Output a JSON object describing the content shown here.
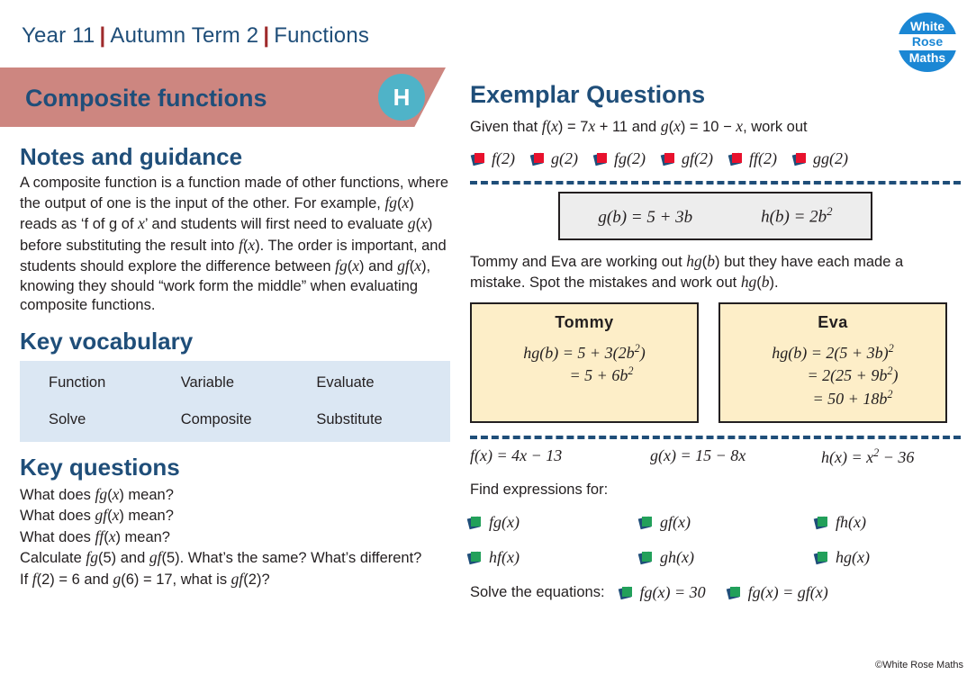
{
  "header": {
    "year": "Year 11",
    "term": "Autumn Term 2",
    "topic": "Functions",
    "separator": "|"
  },
  "logo": {
    "line1": "White",
    "line2": "Rose",
    "line3": "Maths",
    "brand_color": "#1b87d4"
  },
  "banner": {
    "title": "Composite functions",
    "tier_badge": "H",
    "banner_color": "#cd8680",
    "badge_color": "#4fb3c8",
    "title_color": "#1f4e79"
  },
  "left": {
    "notes_heading": "Notes and guidance",
    "notes_body": "A composite function is a function made of other functions, where the output of one is the input of the other. For example, fg(x) reads as ‘f of g of x’ and students will first need to evaluate g(x) before substituting the result into f(x). The order is important, and students should explore the difference between fg(x) and gf(x), knowing they should “work form the middle” when evaluating composite functions.",
    "vocab_heading": "Key vocabulary",
    "vocab_rows": [
      [
        "Function",
        "Variable",
        "Evaluate"
      ],
      [
        "Solve",
        "Composite",
        "Substitute"
      ]
    ],
    "vocab_bg": "#dbe7f3",
    "questions_heading": "Key questions",
    "questions": [
      "What does fg(x) mean?",
      "What does gf(x) mean?",
      "What does ff(x) mean?",
      "Calculate fg(5) and gf(5). What’s the same? What’s different?",
      "If f(2) = 6 and g(6) = 17, what is gf(2)?"
    ]
  },
  "right": {
    "title": "Exemplar Questions",
    "given_text": "Given that f(x) = 7x + 11 and g(x) = 10 − x, work out",
    "q1_bullets": [
      "f(2)",
      "g(2)",
      "fg(2)",
      "gf(2)",
      "ff(2)",
      "gg(2)"
    ],
    "q1_bullet_color": "#e8112d",
    "definition_box": {
      "left": "g(b) = 5 + 3b",
      "right": "h(b) = 2b²"
    },
    "tommy_eva_prompt": "Tommy and Eva are working out hg(b) but they have each made a mistake. Spot the mistakes and work out hg(b).",
    "tommy": {
      "name": "Tommy",
      "lines": [
        "hg(b) = 5 + 3(2b²)",
        "= 5 + 6b²"
      ]
    },
    "eva": {
      "name": "Eva",
      "lines": [
        "hg(b) = 2(5 + 3b)²",
        "= 2(25 + 9b²)",
        "= 50 + 18b²"
      ]
    },
    "card_bg": "#fdeec8",
    "functions": [
      "f(x) = 4x − 13",
      "g(x) = 15 − 8x",
      "h(x) = x² − 36"
    ],
    "find_label": "Find expressions for:",
    "expressions": [
      "fg(x)",
      "gf(x)",
      "fh(x)",
      "hf(x)",
      "gh(x)",
      "hg(x)"
    ],
    "expr_bullet_color": "#22a05a",
    "solve_label": "Solve the equations:",
    "solve_items": [
      "fg(x) = 30",
      "fg(x) = gf(x)"
    ]
  },
  "footer": {
    "copyright": "©White Rose Maths"
  }
}
